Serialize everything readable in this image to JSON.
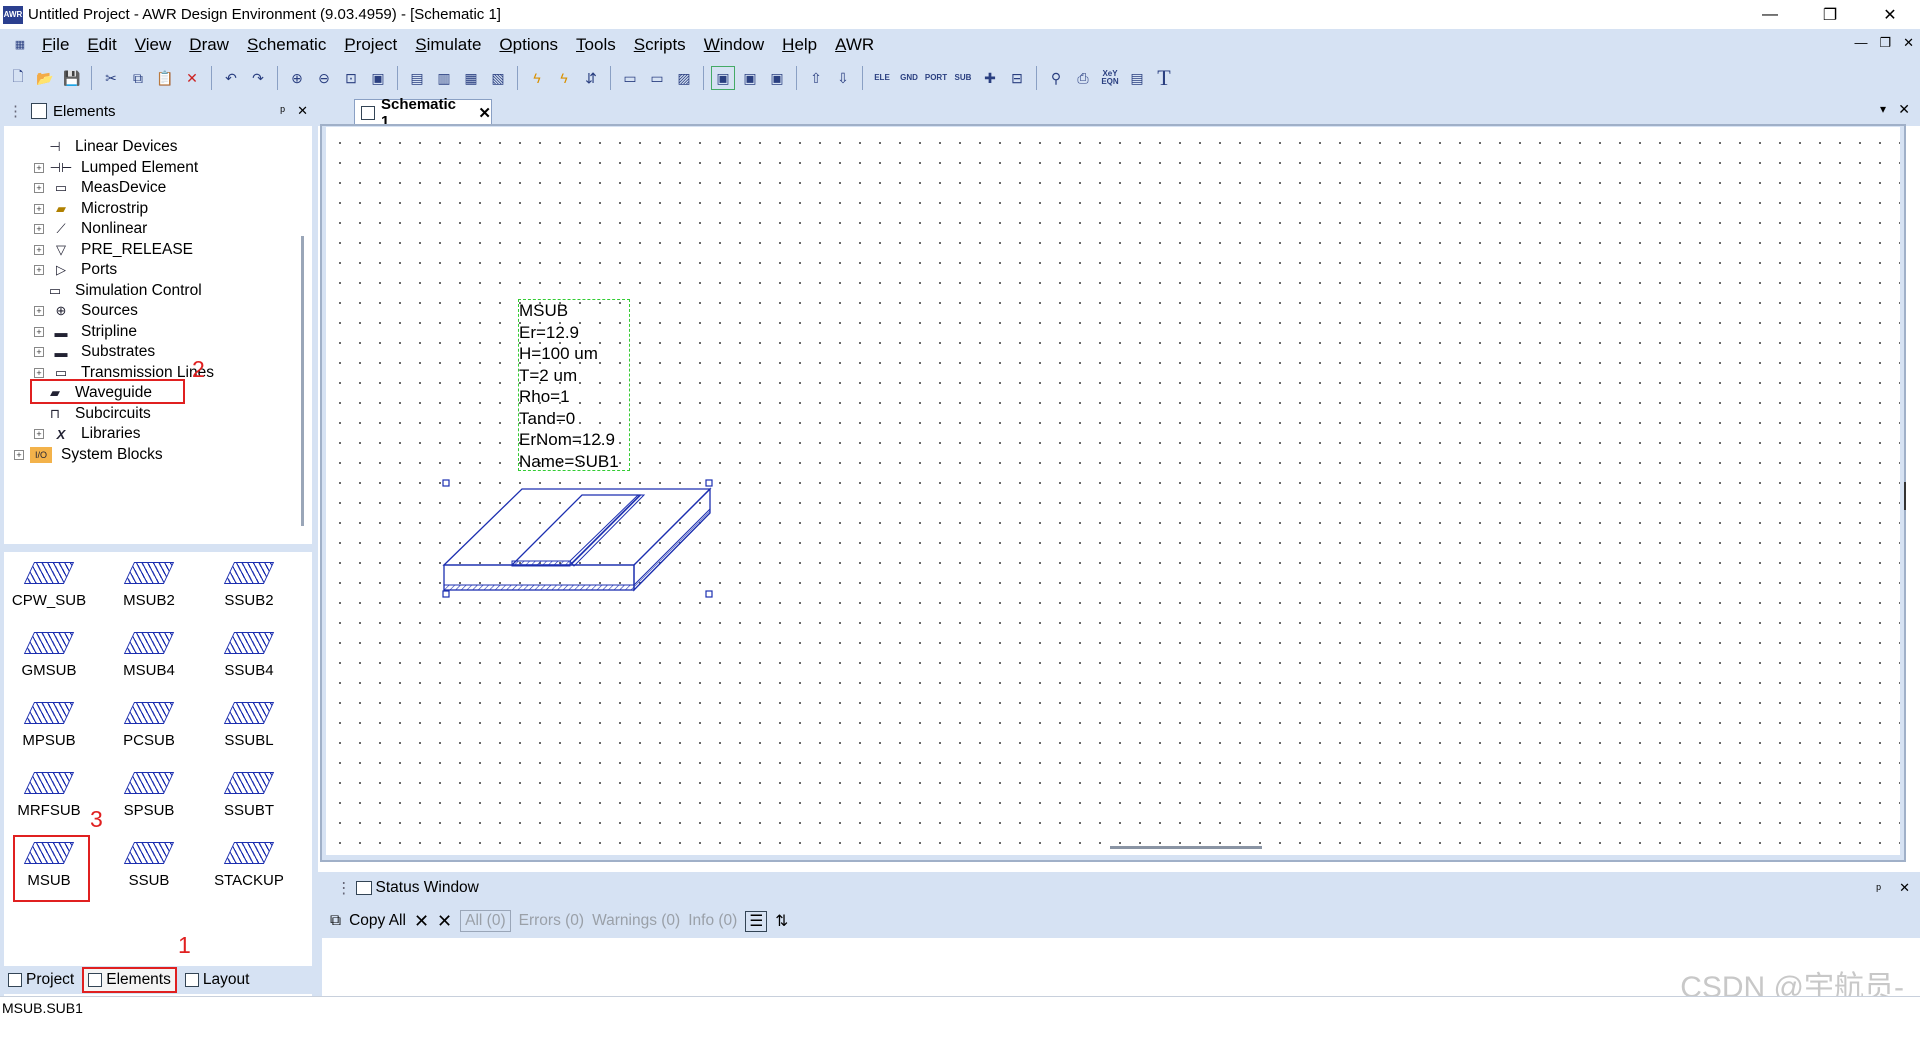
{
  "window": {
    "title": "Untitled Project - AWR Design Environment (9.03.4959) - [Schematic 1]",
    "app_icon_label": "AWR",
    "controls": {
      "minimize": "—",
      "restore": "❐",
      "close": "✕"
    }
  },
  "menu": [
    "File",
    "Edit",
    "View",
    "Draw",
    "Schematic",
    "Project",
    "Simulate",
    "Options",
    "Tools",
    "Scripts",
    "Window",
    "Help",
    "AWR"
  ],
  "toolbar": {
    "small_labels": [
      "ELE",
      "GND",
      "PORT",
      "SUB",
      "XeY EQN"
    ],
    "text_tool": "T"
  },
  "elements_panel": {
    "title": "Elements",
    "pin": "ᵖ",
    "close": "✕",
    "tree": [
      {
        "label": "Linear Devices",
        "icon": "linear-devices-icon"
      },
      {
        "label": "Lumped Element",
        "icon": "capacitor-icon"
      },
      {
        "label": "MeasDevice",
        "icon": "meas-device-icon"
      },
      {
        "label": "Microstrip",
        "icon": "microstrip-icon"
      },
      {
        "label": "Nonlinear",
        "icon": "nonlinear-icon"
      },
      {
        "label": "PRE_RELEASE",
        "icon": "pre-release-icon"
      },
      {
        "label": "Ports",
        "icon": "port-icon"
      },
      {
        "label": "Simulation Control",
        "icon": "simulation-control-icon"
      },
      {
        "label": "Sources",
        "icon": "source-icon"
      },
      {
        "label": "Stripline",
        "icon": "stripline-icon"
      },
      {
        "label": "Substrates",
        "icon": "substrate-icon"
      },
      {
        "label": "Transmission Lines",
        "icon": "transmission-line-icon"
      },
      {
        "label": "Waveguide",
        "icon": "waveguide-icon"
      },
      {
        "label": "Subcircuits",
        "icon": "subcircuit-icon"
      },
      {
        "label": "Libraries",
        "icon": "library-icon"
      },
      {
        "label": "System Blocks",
        "icon": "system-blocks-icon"
      }
    ],
    "substrate_items": [
      "CPW_SUB",
      "MSUB2",
      "SSUB2",
      "GMSUB",
      "MSUB4",
      "SSUB4",
      "MPSUB",
      "PCSUB",
      "SSUBL",
      "MRFSUB",
      "SPSUB",
      "SSUBT",
      "MSUB",
      "SSUB",
      "STACKUP"
    ],
    "bottom_tabs": [
      "Project",
      "Elements",
      "Layout"
    ]
  },
  "annotations": {
    "one": "1",
    "two": "2",
    "three": "3"
  },
  "document": {
    "tab_label": "Schematic 1",
    "msub_params": [
      "MSUB",
      "Er=12.9",
      "H=100 um",
      "T=2 um",
      "Rho=1",
      "Tand=0",
      "ErNom=12.9",
      "Name=SUB1"
    ]
  },
  "status_window": {
    "title": "Status Window",
    "copy_all": "Copy All",
    "filters": [
      "All (0)",
      "Errors (0)",
      "Warnings (0)",
      "Info (0)"
    ]
  },
  "status_bar": {
    "text": "MSUB.SUB1"
  },
  "watermark": "CSDN @宇航员-",
  "colors": {
    "chrome": "#d6e2f3",
    "accent_red": "#e02020",
    "msub_blue": "#1c2fb0",
    "selection_green": "#33cc33"
  }
}
